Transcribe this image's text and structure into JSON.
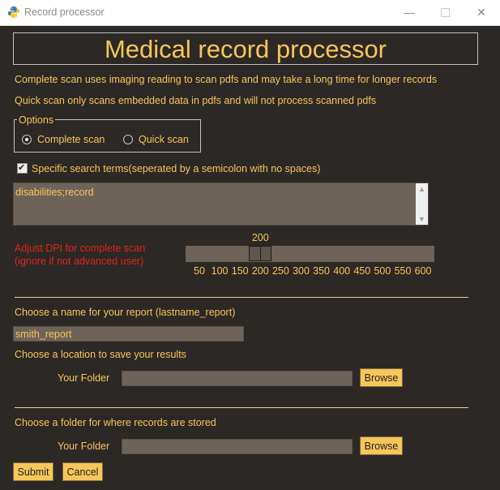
{
  "window": {
    "title": "Record processor",
    "min": "—",
    "close": "✕"
  },
  "header": {
    "title": "Medical record processor"
  },
  "info": {
    "line1": "Complete scan uses imaging reading to scan pdfs and may take a long time for longer records",
    "line2": "Quick scan only scans embedded data in pdfs and will not process scanned pdfs"
  },
  "options": {
    "legend": "Options",
    "complete_label": "Complete scan",
    "quick_label": "Quick scan",
    "selected": "Complete scan"
  },
  "search_terms": {
    "checkbox_label": "Specific search terms(seperated by a semicolon with no spaces)",
    "checked": true,
    "value": "disabilities;record"
  },
  "dpi": {
    "label_line1": "Adjust DPI for complete scan",
    "label_line2": "(ignore if not advanced user)",
    "value": 200,
    "value_text": "200",
    "ticks": [
      "50",
      "100",
      "150",
      "200",
      "250",
      "300",
      "350",
      "400",
      "450",
      "500",
      "550",
      "600"
    ]
  },
  "report": {
    "name_label": "Choose a name for your report (lastname_report)",
    "name_value": "smith_report",
    "location_label": "Choose a location to save your results",
    "folder_label": "Your Folder",
    "folder_value": "",
    "browse_label": "Browse"
  },
  "records": {
    "folder_prompt": "Choose a folder for where records are stored",
    "folder_label": "Your Folder",
    "folder_value": "",
    "browse_label": "Browse"
  },
  "actions": {
    "submit_label": "Submit",
    "cancel_label": "Cancel"
  },
  "colors": {
    "background": "#2c2825",
    "accent": "#f7c65a",
    "warning": "#e0271f",
    "field": "#6e6358"
  }
}
